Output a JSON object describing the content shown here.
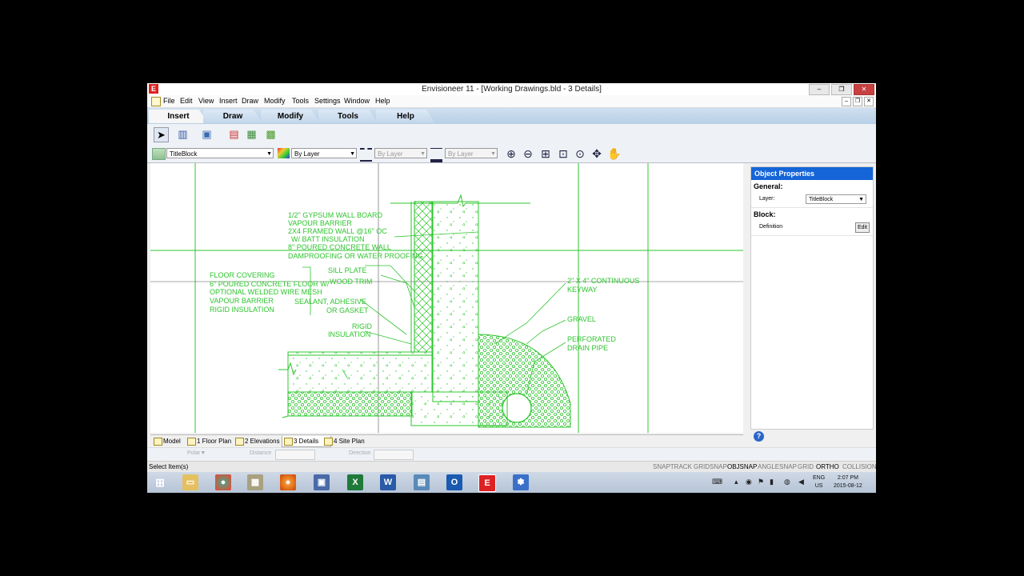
{
  "window": {
    "title": "Envisioneer 11 - [Working Drawings.bld - 3 Details]"
  },
  "menu": [
    "File",
    "Edit",
    "View",
    "Insert",
    "Draw",
    "Modify",
    "Tools",
    "Settings",
    "Window",
    "Help"
  ],
  "ribbon_tabs": [
    "Insert",
    "Draw",
    "Modify",
    "Tools",
    "Help"
  ],
  "toolbar2": {
    "layer_value": "TitleBlock",
    "color_value": "By Layer",
    "linetype_value": "By Layer",
    "lineweight_value": "By Layer"
  },
  "drawing_labels": {
    "wall_1": "1/2\" GYPSUM WALL BOARD",
    "wall_2": "VAPOUR BARRIER",
    "wall_3": "2X4 FRAMED WALL @16\" OC",
    "wall_4": "W/ BATT INSULATION",
    "wall_5": "8\" POURED CONCRETE WALL",
    "wall_6": "DAMPROOFING OR WATER PROOFING",
    "floor_1": "FLOOR COVERING",
    "floor_2": "6\" POURED CONCRETE FLOOR W/",
    "floor_3": "OPTIONAL WELDED WIRE MESH",
    "floor_4": "VAPOUR BARRIER",
    "floor_5": "RIGID INSULATION",
    "sill_plate": "SILL PLATE",
    "wood_trim": "WOOD TRIM",
    "sealant_1": "SEALANT, ADHESIVE",
    "sealant_2": "OR GASKET",
    "rigid_1": "RIGID",
    "rigid_2": "INSULATION",
    "keyway_1": "2\" X 4\" CONTINUOUS",
    "keyway_2": "KEYWAY",
    "gravel": "GRAVEL",
    "drain_1": "PERFORATED",
    "drain_2": "DRAIN PIPE"
  },
  "properties": {
    "header": "Object Properties",
    "general": "General:",
    "layer_label": "Layer:",
    "layer_value": "TitleBlock",
    "block": "Block:",
    "definition_label": "Definition",
    "edit_label": "Edit"
  },
  "layout_tabs": [
    "Model",
    "1 Floor Plan",
    "2 Elevations",
    "3 Details",
    "4 Site Plan"
  ],
  "polar": {
    "polar_label": "Polar▼",
    "distance_label": "Distance",
    "direction_label": "Direction"
  },
  "status": {
    "message": "Select Item(s)",
    "modes": [
      "SNAPTRACK",
      "GRIDSNAP",
      "OBJSNAP",
      "ANGLESNAP",
      "GRID",
      "ORTHO",
      "COLLISION"
    ]
  },
  "taskbar": {
    "lang1": "ENG",
    "lang2": "US",
    "time": "2:07 PM",
    "date": "2015-08-12"
  },
  "colors": {
    "cad_green": "#2ec42e",
    "panel_blue": "#1565d8"
  }
}
